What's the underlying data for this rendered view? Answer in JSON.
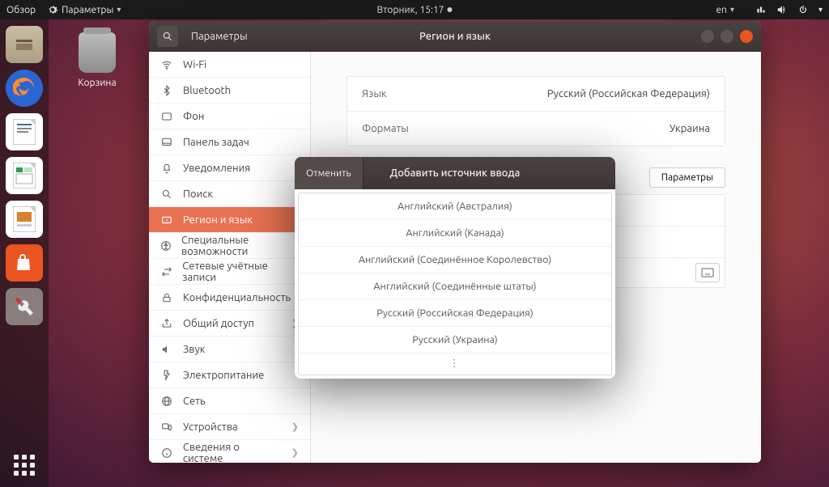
{
  "top_panel": {
    "overview": "Обзор",
    "active_app": "Параметры",
    "clock": "Вторник, 15:17",
    "lang_indicator": "en"
  },
  "desktop": {
    "trash_label": "Корзина"
  },
  "dock": {
    "apps": [
      "files",
      "firefox",
      "writer",
      "calc",
      "impress",
      "software",
      "settings"
    ]
  },
  "window": {
    "titlebar_left": "Параметры",
    "titlebar_center": "Регион и язык",
    "sidebar": [
      {
        "icon": "wifi",
        "label": "Wi-Fi"
      },
      {
        "icon": "bt",
        "label": "Bluetooth"
      },
      {
        "icon": "bg",
        "label": "Фон"
      },
      {
        "icon": "dock",
        "label": "Панель задач"
      },
      {
        "icon": "bell",
        "label": "Уведомления"
      },
      {
        "icon": "search",
        "label": "Поиск"
      },
      {
        "icon": "region",
        "label": "Регион и язык",
        "selected": true
      },
      {
        "icon": "a11y",
        "label": "Специальные возможности"
      },
      {
        "icon": "online",
        "label": "Сетевые учётные записи"
      },
      {
        "icon": "privacy",
        "label": "Конфиденциальность"
      },
      {
        "icon": "share",
        "label": "Общий доступ",
        "chev": true
      },
      {
        "icon": "sound",
        "label": "Звук"
      },
      {
        "icon": "power",
        "label": "Электропитание"
      },
      {
        "icon": "net",
        "label": "Сеть"
      },
      {
        "icon": "devices",
        "label": "Устройства",
        "chev": true
      },
      {
        "icon": "about",
        "label": "Сведения о системе",
        "chev": true
      }
    ],
    "content": {
      "lang_label": "Язык",
      "lang_value": "Русский (Российская Федерация)",
      "formats_label": "Форматы",
      "formats_value": "Украина",
      "params_button": "Параметры"
    }
  },
  "modal": {
    "cancel": "Отменить",
    "title": "Добавить источник ввода",
    "options": [
      "Английский (Австралия)",
      "Английский (Канада)",
      "Английский (Соединённое Королевство)",
      "Английский (Соединённые штаты)",
      "Русский (Российская Федерация)",
      "Русский (Украина)"
    ]
  }
}
